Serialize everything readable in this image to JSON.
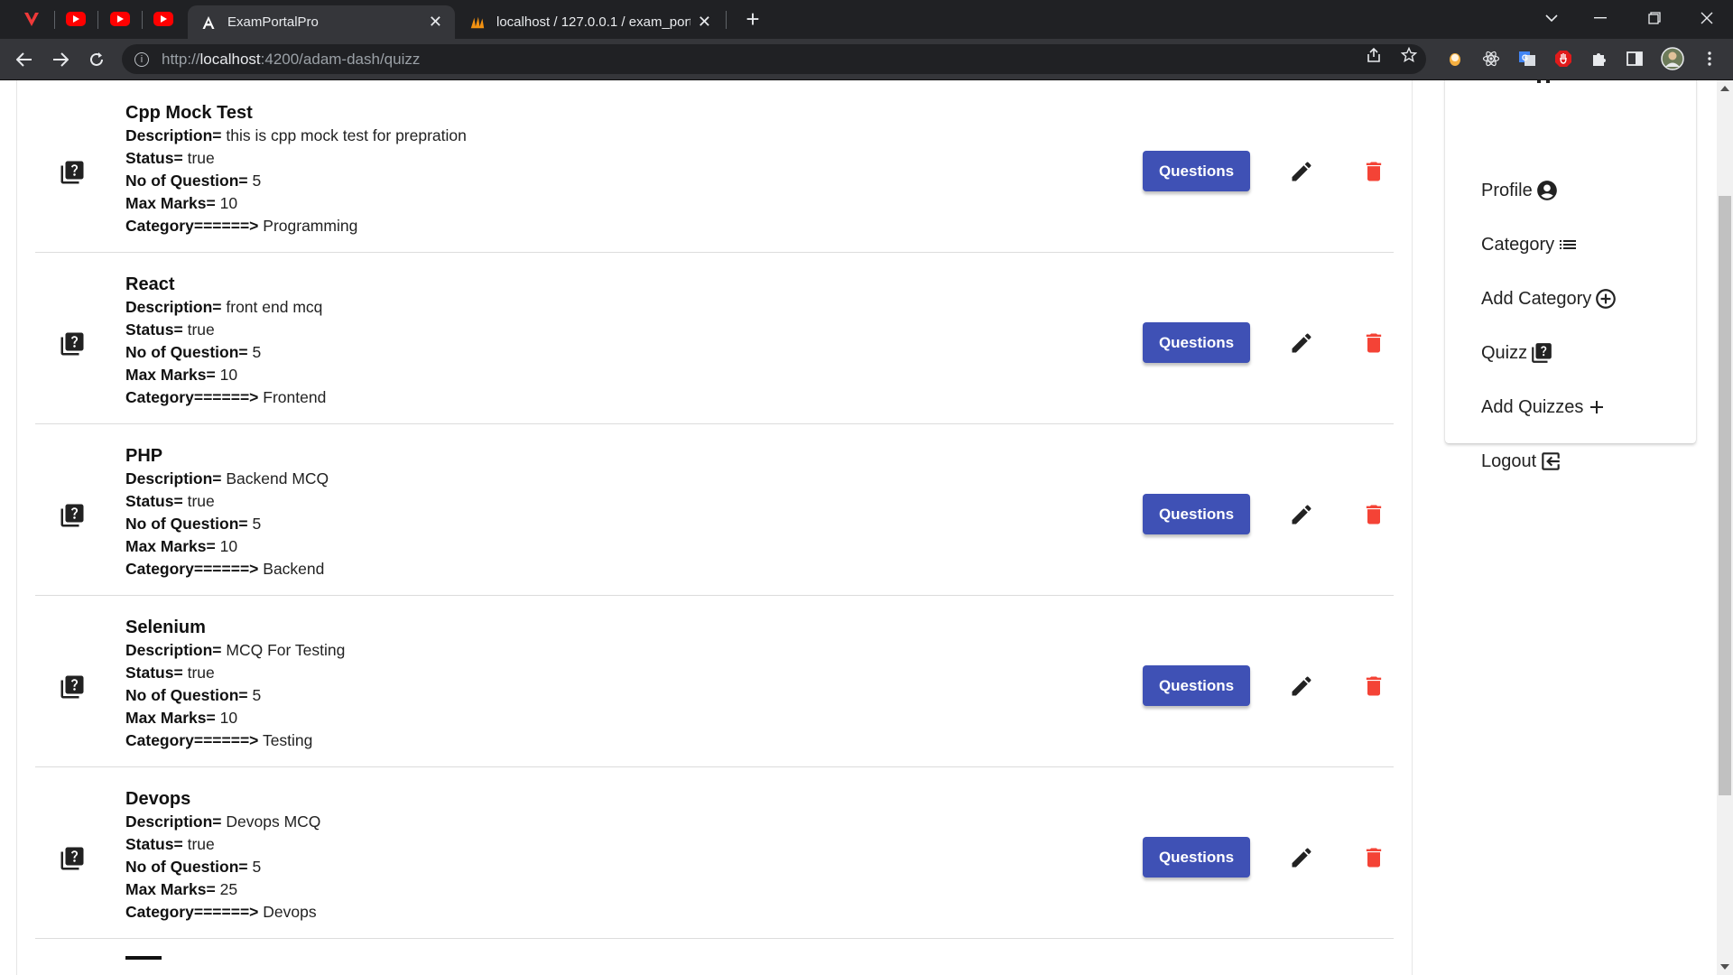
{
  "browser": {
    "tabs": [
      {
        "title": "ExamPortalPro",
        "active": true,
        "icon": "angular-icon"
      },
      {
        "title": "localhost / 127.0.0.1 / exam_port",
        "active": false,
        "icon": "phpmyadmin-icon"
      }
    ],
    "url_prefix": "http://",
    "url_host": "localhost",
    "url_rest": ":4200/adam-dash/quizz"
  },
  "quizzes": [
    {
      "title": "Cpp Mock Test",
      "description": "this is cpp mock test for prepration",
      "status": "true",
      "questions": "5",
      "max_marks": "10",
      "category": "Programming"
    },
    {
      "title": "React",
      "description": "front end mcq",
      "status": "true",
      "questions": "5",
      "max_marks": "10",
      "category": "Frontend"
    },
    {
      "title": "PHP",
      "description": "Backend MCQ",
      "status": "true",
      "questions": "5",
      "max_marks": "10",
      "category": "Backend"
    },
    {
      "title": "Selenium",
      "description": "MCQ For Testing",
      "status": "true",
      "questions": "5",
      "max_marks": "10",
      "category": "Testing"
    },
    {
      "title": "Devops",
      "description": "Devops MCQ",
      "status": "true",
      "questions": "5",
      "max_marks": "25",
      "category": "Devops"
    }
  ],
  "labels": {
    "description": "Description=",
    "status": "Status=",
    "questions": "No of Question=",
    "max_marks": "Max Marks=",
    "category": "Category======>",
    "questions_button": "Questions"
  },
  "sidebar": {
    "items": [
      {
        "label": "Profile",
        "icon": "account-circle-icon"
      },
      {
        "label": "Category",
        "icon": "list-icon"
      },
      {
        "label": "Add Category",
        "icon": "add-circle-icon"
      },
      {
        "label": "Quizz",
        "icon": "quiz-icon"
      },
      {
        "label": "Add Quizzes",
        "icon": "plus-icon"
      },
      {
        "label": "Logout",
        "icon": "logout-icon"
      }
    ]
  },
  "colors": {
    "primary_button": "#3f51b5",
    "delete_icon": "#f44336",
    "chrome_dark": "#202124"
  }
}
